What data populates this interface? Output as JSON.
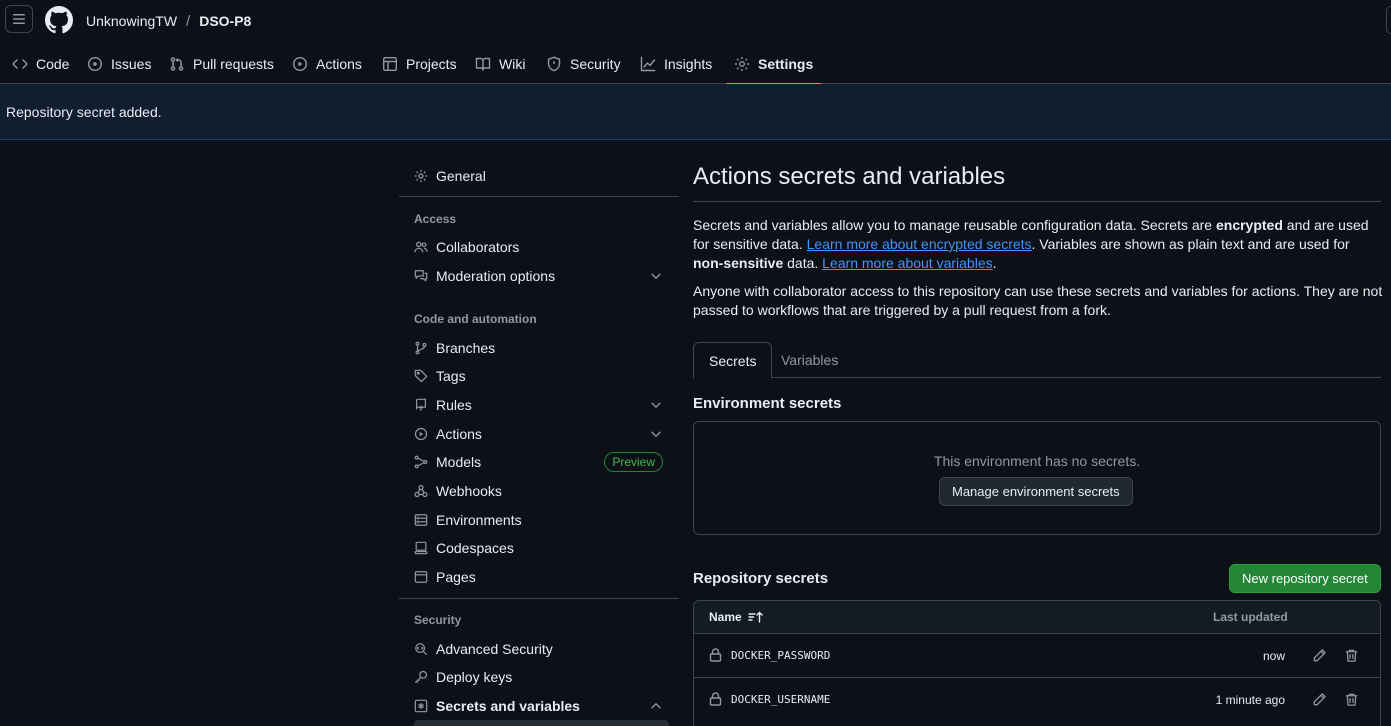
{
  "header": {
    "owner": "UnknowingTW",
    "separator": "/",
    "repo": "DSO-P8"
  },
  "repo_nav": {
    "tabs": [
      {
        "label": "Code",
        "icon": "code-icon"
      },
      {
        "label": "Issues",
        "icon": "issue-opened-icon"
      },
      {
        "label": "Pull requests",
        "icon": "git-pull-request-icon"
      },
      {
        "label": "Actions",
        "icon": "play-icon"
      },
      {
        "label": "Projects",
        "icon": "table-icon"
      },
      {
        "label": "Wiki",
        "icon": "book-icon"
      },
      {
        "label": "Security",
        "icon": "shield-icon"
      },
      {
        "label": "Insights",
        "icon": "graph-icon"
      },
      {
        "label": "Settings",
        "icon": "gear-icon",
        "active": true
      }
    ]
  },
  "flash": {
    "message": "Repository secret added."
  },
  "sidebar": {
    "general": "General",
    "access_heading": "Access",
    "collaborators": "Collaborators",
    "moderation": "Moderation options",
    "code_heading": "Code and automation",
    "branches": "Branches",
    "tags": "Tags",
    "rules": "Rules",
    "actions": "Actions",
    "models": "Models",
    "models_badge": "Preview",
    "webhooks": "Webhooks",
    "environments": "Environments",
    "codespaces": "Codespaces",
    "pages": "Pages",
    "security_heading": "Security",
    "advanced_security": "Advanced Security",
    "deploy_keys": "Deploy keys",
    "secrets_and_variables": "Secrets and variables"
  },
  "main": {
    "title": "Actions secrets and variables",
    "intro": {
      "t1": "Secrets and variables allow you to manage reusable configuration data. Secrets are ",
      "b1": "encrypted",
      "t2": " and are used for sensitive data. ",
      "link1": "Learn more about encrypted secrets",
      "t3": ". Variables are shown as plain text and are used for ",
      "b2": "non-sensitive",
      "t4": " data. ",
      "link2": "Learn more about variables",
      "t5": "."
    },
    "access_note": "Anyone with collaborator access to this repository can use these secrets and variables for actions. They are not passed to workflows that are triggered by a pull request from a fork.",
    "tabs": {
      "secrets": "Secrets",
      "variables": "Variables"
    },
    "env_secrets": {
      "heading": "Environment secrets",
      "empty_message": "This environment has no secrets.",
      "manage_button": "Manage environment secrets"
    },
    "repo_secrets": {
      "heading": "Repository secrets",
      "new_button": "New repository secret",
      "col_name": "Name",
      "col_updated": "Last updated",
      "rows": [
        {
          "name": "DOCKER_PASSWORD",
          "updated": "now"
        },
        {
          "name": "DOCKER_USERNAME",
          "updated": "1 minute ago"
        }
      ]
    }
  },
  "colors": {
    "background": "#0d1117",
    "accent_link": "#4493f8",
    "active_tab_underline": "#f78166",
    "primary_button": "#238636",
    "flash_background": "#121d2f"
  }
}
